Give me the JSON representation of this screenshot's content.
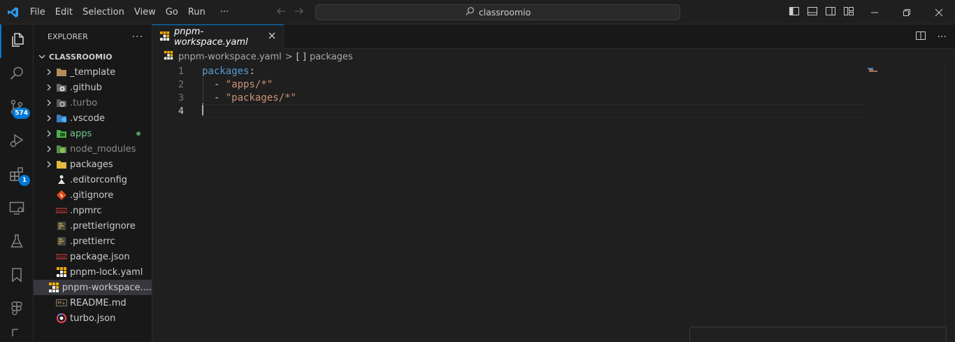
{
  "menu": {
    "items": [
      "File",
      "Edit",
      "Selection",
      "View",
      "Go",
      "Run",
      "···"
    ]
  },
  "command_center": {
    "text": "classroomio"
  },
  "activity_bar": {
    "source_control_badge": "574",
    "extensions_badge": "1"
  },
  "explorer": {
    "title": "EXPLORER",
    "more": "···",
    "root": "CLASSROOMIO",
    "items": [
      {
        "label": "_template",
        "type": "folder"
      },
      {
        "label": ".github",
        "type": "folder"
      },
      {
        "label": ".turbo",
        "type": "folder"
      },
      {
        "label": ".vscode",
        "type": "folder"
      },
      {
        "label": "apps",
        "type": "folder"
      },
      {
        "label": "node_modules",
        "type": "folder"
      },
      {
        "label": "packages",
        "type": "folder"
      },
      {
        "label": ".editorconfig",
        "type": "file"
      },
      {
        "label": ".gitignore",
        "type": "file"
      },
      {
        "label": ".npmrc",
        "type": "file"
      },
      {
        "label": ".prettierignore",
        "type": "file"
      },
      {
        "label": ".prettierrc",
        "type": "file"
      },
      {
        "label": "package.json",
        "type": "file"
      },
      {
        "label": "pnpm-lock.yaml",
        "type": "file"
      },
      {
        "label": "pnpm-workspace....",
        "type": "file"
      },
      {
        "label": "README.md",
        "type": "file"
      },
      {
        "label": "turbo.json",
        "type": "file"
      }
    ]
  },
  "editor": {
    "tab_label": "pnpm-workspace.yaml",
    "breadcrumb": {
      "file": "pnpm-workspace.yaml",
      "separator": ">",
      "symbol_icon": "[ ]",
      "symbol": "packages"
    },
    "lines": [
      {
        "num": "1",
        "key": "packages",
        "colon": ":"
      },
      {
        "num": "2",
        "dash": "  - ",
        "value": "\"apps/*\""
      },
      {
        "num": "3",
        "dash": "  - ",
        "value": "\"packages/*\""
      },
      {
        "num": "4"
      }
    ]
  },
  "colors": {
    "accent": "#0078d4",
    "yaml_key": "#569cd6",
    "yaml_string": "#ce9178",
    "git_added": "#73c991"
  }
}
